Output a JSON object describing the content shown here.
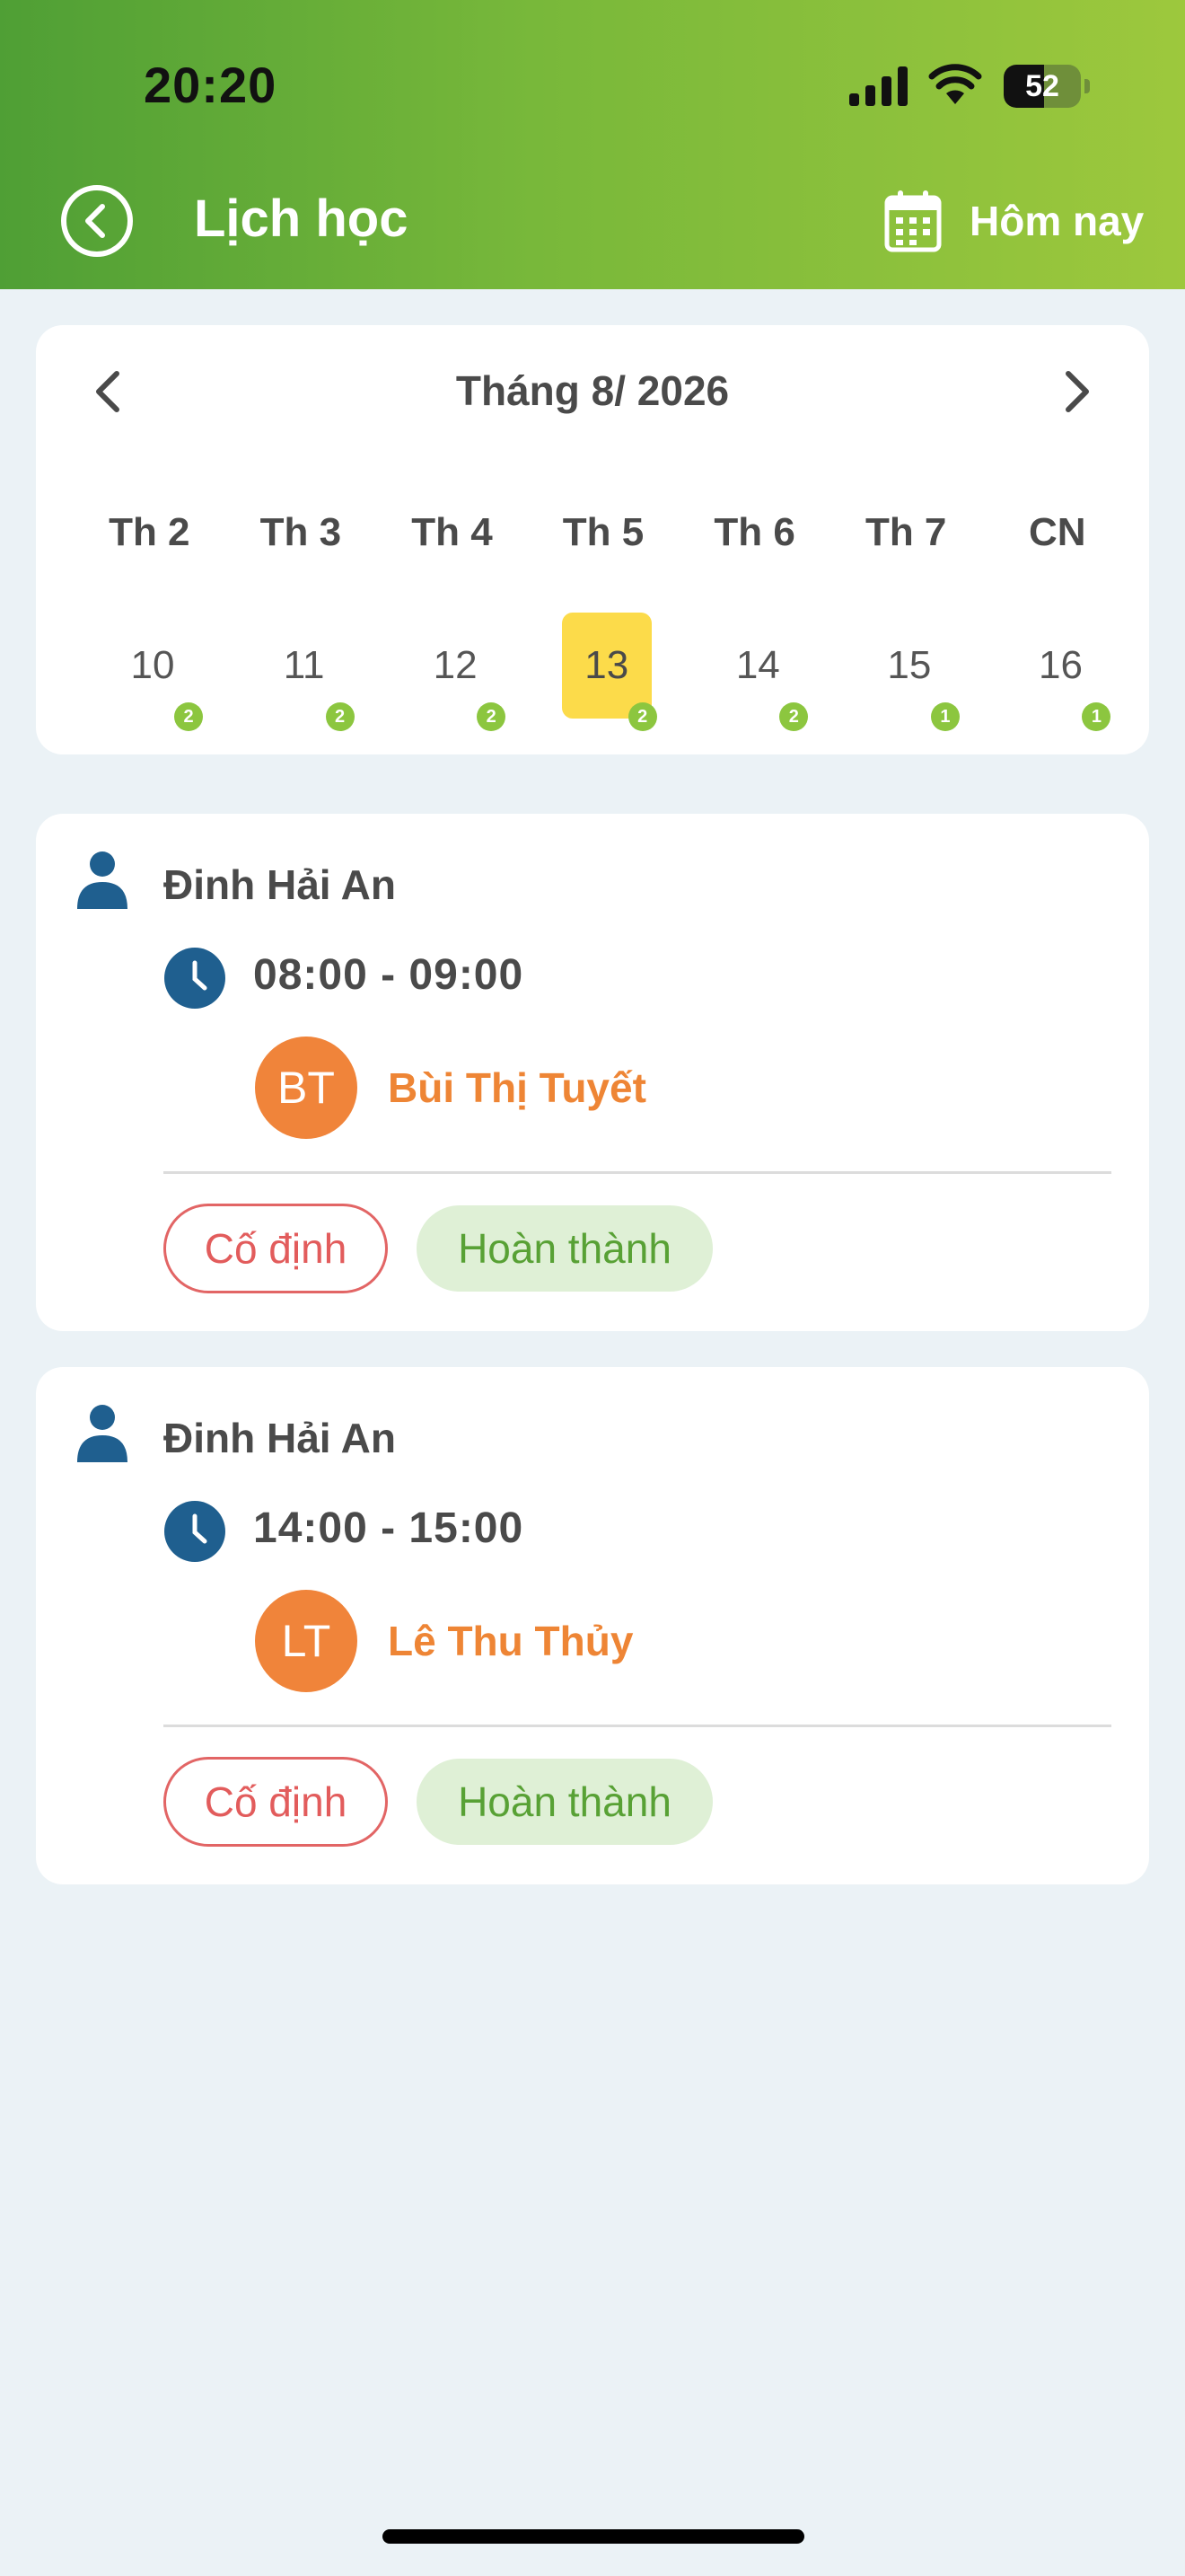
{
  "status_bar": {
    "time": "20:20",
    "battery_level": "52",
    "battery_fraction": 0.52
  },
  "header": {
    "title": "Lịch học",
    "today_label": "Hôm nay"
  },
  "calendar": {
    "month_label": "Tháng 8/ 2026",
    "weekdays": [
      "Th 2",
      "Th 3",
      "Th 4",
      "Th 5",
      "Th 6",
      "Th 7",
      "CN"
    ],
    "days": [
      {
        "day": "10",
        "count": "2"
      },
      {
        "day": "11",
        "count": "2"
      },
      {
        "day": "12",
        "count": "2"
      },
      {
        "day": "13",
        "count": "2"
      },
      {
        "day": "14",
        "count": "2"
      },
      {
        "day": "15",
        "count": "1"
      },
      {
        "day": "16",
        "count": "1"
      }
    ],
    "selected_day": "13"
  },
  "sessions": [
    {
      "student": "Đinh Hải An",
      "time": "08:00 - 09:00",
      "teacher_initials": "BT",
      "teacher": "Bùi Thị Tuyết",
      "tag_type": "Cố định",
      "tag_status": "Hoàn thành"
    },
    {
      "student": "Đinh Hải An",
      "time": "14:00 - 15:00",
      "teacher_initials": "LT",
      "teacher": "Lê Thu Thủy",
      "tag_type": "Cố định",
      "tag_status": "Hoàn thành"
    }
  ],
  "colors": {
    "header_start": "#4f9f35",
    "header_end": "#9dc83d",
    "selected_day": "#fcdb4a",
    "badge": "#8cc63f",
    "avatar": "#f0843a",
    "teacher_name": "#ee8535",
    "tag_fixed": "#e25c5c",
    "tag_done_bg": "#dff0d6",
    "tag_done_text": "#58a135",
    "icon_blue": "#1f5f8f"
  }
}
